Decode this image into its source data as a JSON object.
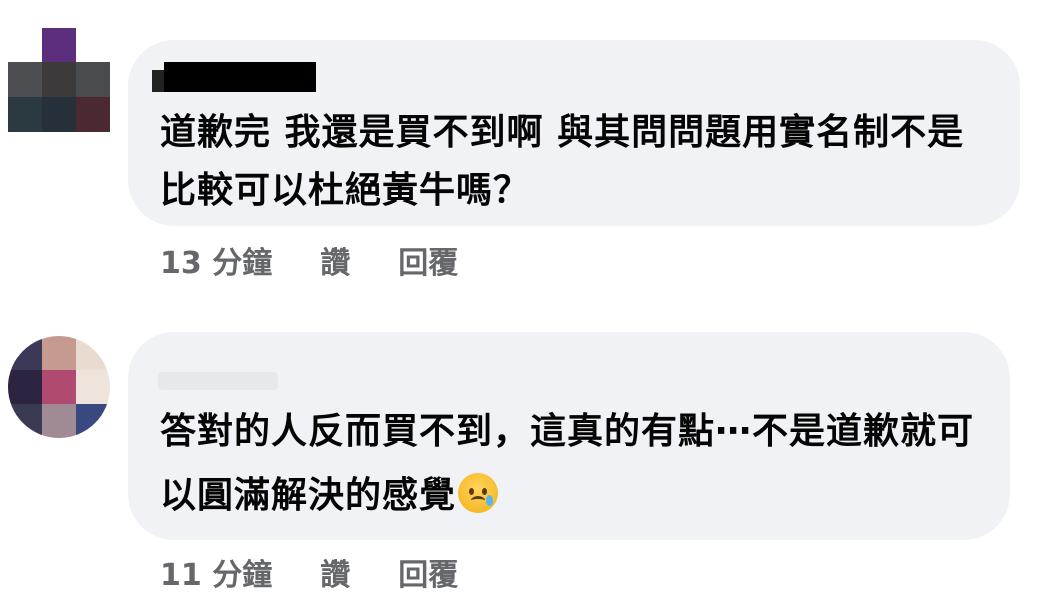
{
  "comments": [
    {
      "text": "道歉完 我還是買不到啊 與其問問題用實名制不是比較可以杜絕黃牛嗎？",
      "time": "13 分鐘",
      "like_label": "讚",
      "reply_label": "回覆"
    },
    {
      "text": "答對的人反而買不到，這真的有點⋯不是道歉就可以圓滿解決的感覺",
      "emoji": "crying-face-icon",
      "time": "11 分鐘",
      "like_label": "讚",
      "reply_label": "回覆"
    }
  ]
}
